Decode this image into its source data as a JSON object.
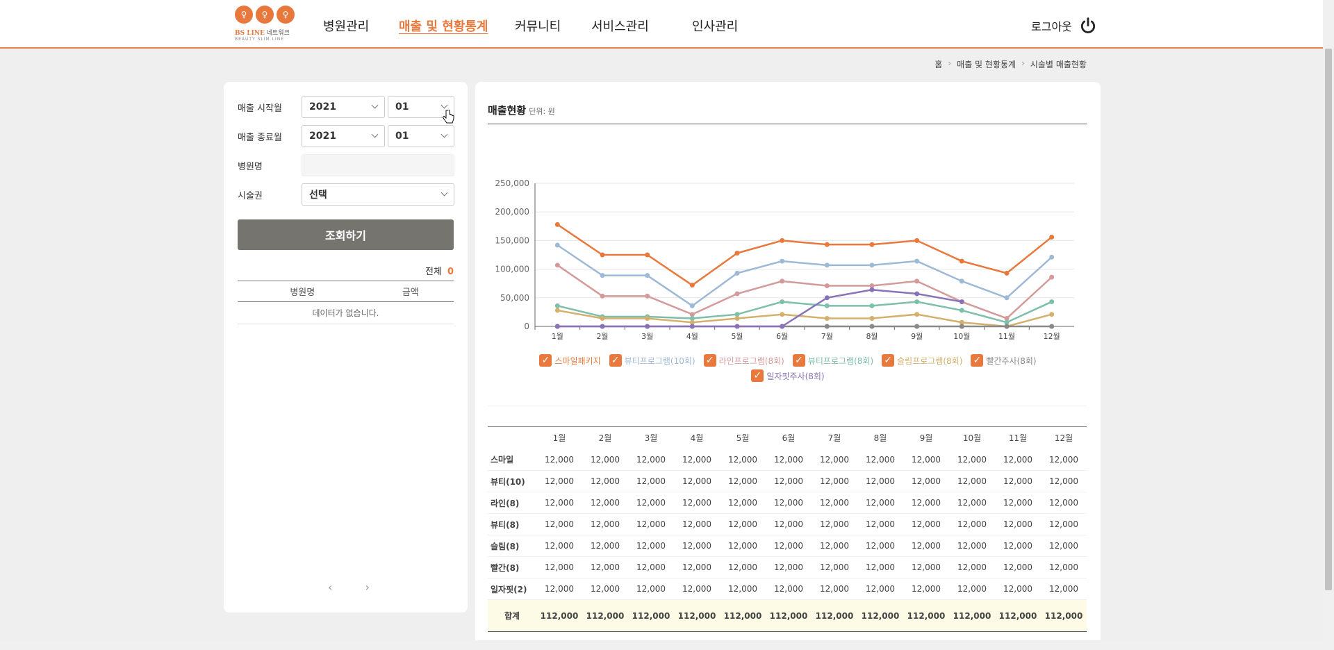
{
  "header": {
    "logo_text": "BS LINE",
    "logo_sub_ko": "네트워크",
    "logo_tagline": "BEAUTY SLIM LINE",
    "nav": [
      {
        "label": "병원관리",
        "active": false
      },
      {
        "label": "매출 및 현황통계",
        "active": true
      },
      {
        "label": "커뮤니티",
        "active": false
      },
      {
        "label": "서비스관리",
        "active": false
      },
      {
        "label": "인사관리",
        "active": false
      }
    ],
    "logout_label": "로그아웃"
  },
  "breadcrumb": [
    "홈",
    "매출 및 현황통계",
    "시술별 매출현황"
  ],
  "filters": {
    "start_label": "매출 시작월",
    "start_year": "2021",
    "start_month": "01",
    "end_label": "매출 종료월",
    "end_year": "2021",
    "end_month": "01",
    "hospital_label": "병원명",
    "hospital_value": "",
    "ticket_label": "시술권",
    "ticket_value": "선택",
    "search_button": "조회하기",
    "total_label": "전체",
    "total_count": "0",
    "columns": [
      "병원명",
      "금액"
    ],
    "empty_text": "데이터가 없습니다.",
    "pager_prev": "‹",
    "pager_next": "›"
  },
  "report": {
    "title": "매출현황",
    "unit": "단위: 원"
  },
  "colors": {
    "accent": "#e8783c"
  },
  "chart_data": {
    "type": "line",
    "categories": [
      "1월",
      "2월",
      "3월",
      "4월",
      "5월",
      "6월",
      "7월",
      "8월",
      "9월",
      "10월",
      "11월",
      "12월"
    ],
    "ylim": [
      0,
      250000
    ],
    "yticks": [
      0,
      50000,
      100000,
      150000,
      200000,
      250000
    ],
    "ytick_labels": [
      "0",
      "50,000",
      "100,000",
      "150,000",
      "200,000",
      "250,000"
    ],
    "grid": true,
    "legend_position": "bottom",
    "series": [
      {
        "name": "스마일패키지",
        "color": "#e8783c",
        "values": [
          178000,
          125000,
          125000,
          72000,
          128000,
          150000,
          143000,
          143000,
          150000,
          114000,
          93000,
          156000
        ]
      },
      {
        "name": "뷰티프로그램(10회)",
        "color": "#9db9d6",
        "values": [
          142000,
          89000,
          89000,
          36000,
          93000,
          114000,
          107000,
          107000,
          114000,
          79000,
          50000,
          121000
        ]
      },
      {
        "name": "라인프로그램(8회)",
        "color": "#d49a9a",
        "values": [
          107000,
          53000,
          53000,
          21000,
          57000,
          79000,
          71000,
          71000,
          79000,
          43000,
          14000,
          86000
        ]
      },
      {
        "name": "뷰티프로그램(8회)",
        "color": "#7dbfa8",
        "values": [
          36000,
          17000,
          17000,
          14000,
          21000,
          43000,
          36000,
          36000,
          43000,
          28000,
          7000,
          43000
        ]
      },
      {
        "name": "슬림프로그램(8회)",
        "color": "#d4b06c",
        "values": [
          28000,
          14000,
          14000,
          7000,
          14000,
          21000,
          14000,
          14000,
          21000,
          7000,
          0,
          21000
        ]
      },
      {
        "name": "빨간주사(8회)",
        "color": "#888888",
        "values": [
          0,
          0,
          0,
          0,
          0,
          0,
          0,
          0,
          0,
          0,
          0,
          0
        ]
      },
      {
        "name": "일자핏주사(8회)",
        "color": "#8a72b8",
        "values": [
          0,
          0,
          0,
          0,
          0,
          0,
          50000,
          64000,
          57000,
          43000,
          null,
          null
        ]
      }
    ]
  },
  "table": {
    "months": [
      "1월",
      "2월",
      "3월",
      "4월",
      "5월",
      "6월",
      "7월",
      "8월",
      "9월",
      "10월",
      "11월",
      "12월"
    ],
    "rows": [
      {
        "label": "스마일",
        "values": [
          "12,000",
          "12,000",
          "12,000",
          "12,000",
          "12,000",
          "12,000",
          "12,000",
          "12,000",
          "12,000",
          "12,000",
          "12,000",
          "12,000"
        ]
      },
      {
        "label": "뷰티(10)",
        "values": [
          "12,000",
          "12,000",
          "12,000",
          "12,000",
          "12,000",
          "12,000",
          "12,000",
          "12,000",
          "12,000",
          "12,000",
          "12,000",
          "12,000"
        ]
      },
      {
        "label": "라인(8)",
        "values": [
          "12,000",
          "12,000",
          "12,000",
          "12,000",
          "12,000",
          "12,000",
          "12,000",
          "12,000",
          "12,000",
          "12,000",
          "12,000",
          "12,000"
        ]
      },
      {
        "label": "뷰티(8)",
        "values": [
          "12,000",
          "12,000",
          "12,000",
          "12,000",
          "12,000",
          "12,000",
          "12,000",
          "12,000",
          "12,000",
          "12,000",
          "12,000",
          "12,000"
        ]
      },
      {
        "label": "슬림(8)",
        "values": [
          "12,000",
          "12,000",
          "12,000",
          "12,000",
          "12,000",
          "12,000",
          "12,000",
          "12,000",
          "12,000",
          "12,000",
          "12,000",
          "12,000"
        ]
      },
      {
        "label": "빨간(8)",
        "values": [
          "12,000",
          "12,000",
          "12,000",
          "12,000",
          "12,000",
          "12,000",
          "12,000",
          "12,000",
          "12,000",
          "12,000",
          "12,000",
          "12,000"
        ]
      },
      {
        "label": "일자핏(2)",
        "values": [
          "12,000",
          "12,000",
          "12,000",
          "12,000",
          "12,000",
          "12,000",
          "12,000",
          "12,000",
          "12,000",
          "12,000",
          "12,000",
          "12,000"
        ]
      }
    ],
    "total_label": "합계",
    "totals": [
      "112,000",
      "112,000",
      "112,000",
      "112,000",
      "112,000",
      "112,000",
      "112,000",
      "112,000",
      "112,000",
      "112,000",
      "112,000",
      "112,000"
    ]
  }
}
